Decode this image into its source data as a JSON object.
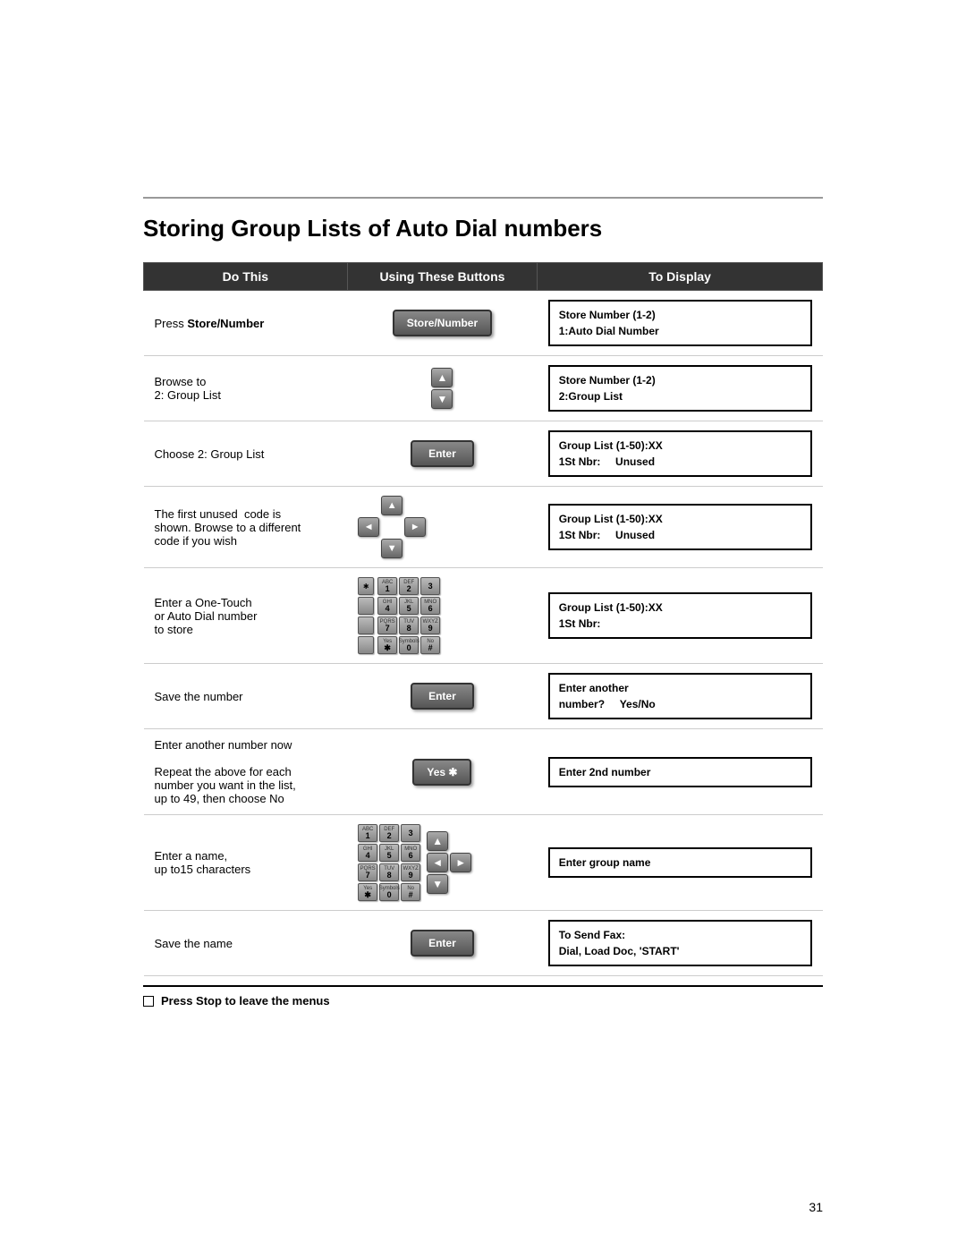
{
  "page": {
    "title": "Storing Group Lists of Auto Dial numbers",
    "page_number": "31"
  },
  "header_row": {
    "col1": "Do This",
    "col2": "Using These Buttons",
    "col3": "To Display"
  },
  "rows": [
    {
      "id": "row1",
      "do_text": "Press Store/Number",
      "do_bold": "Store/Number",
      "btn_type": "store_number",
      "btn_label": "Store/Number",
      "display_line1": "Store Number (1-2)",
      "display_line2": "1:Auto Dial Number"
    },
    {
      "id": "row2",
      "do_text_line1": "Browse to",
      "do_text_line2": "2: Group List",
      "btn_type": "up_down",
      "display_line1": "Store Number (1-2)",
      "display_line2": "2:Group List"
    },
    {
      "id": "row3",
      "do_text": "Choose 2: Group List",
      "btn_type": "enter",
      "btn_label": "Enter",
      "display_line1": "Group List (1-50):XX",
      "display_line2": "1St Nbr:     Unused"
    },
    {
      "id": "row4",
      "do_text_line1": "The first unused  code is",
      "do_text_line2": "shown. Browse to a different",
      "do_text_line3": "code if you wish",
      "btn_type": "cross",
      "display_line1": "Group List (1-50):XX",
      "display_line2": "1St Nbr:     Unused"
    },
    {
      "id": "row5",
      "do_text_line1": "Enter a One-Touch",
      "do_text_line2": "or Auto Dial number",
      "do_text_line3": "to store",
      "btn_type": "keypad",
      "display_line1": "Group List (1-50):XX",
      "display_line2": "1St Nbr:"
    },
    {
      "id": "row6",
      "do_text": "Save the number",
      "btn_type": "enter",
      "btn_label": "Enter",
      "display_line1": "Enter another",
      "display_line2": "number?     Yes/No"
    },
    {
      "id": "row7",
      "do_text_line1": "Enter another number now",
      "do_text_line2": "",
      "do_text_line3": "Repeat the above for each",
      "do_text_line4": "number you want in the list,",
      "do_text_line5": "up to 49, then choose No",
      "btn_type": "yes_star",
      "btn_label": "Yes ✱",
      "display_line1": "Enter 2nd number",
      "display_line2": ""
    },
    {
      "id": "row8",
      "do_text_line1": "Enter a name,",
      "do_text_line2": "up to15 characters",
      "btn_type": "keypad_cross",
      "display_line1": "Enter group name",
      "display_line2": ""
    },
    {
      "id": "row9",
      "do_text": "Save the name",
      "btn_type": "enter",
      "btn_label": "Enter",
      "display_line1": "To Send Fax:",
      "display_line2": "Dial, Load Doc, 'START'"
    }
  ],
  "footer": {
    "note": "Press Stop to leave the menus"
  }
}
